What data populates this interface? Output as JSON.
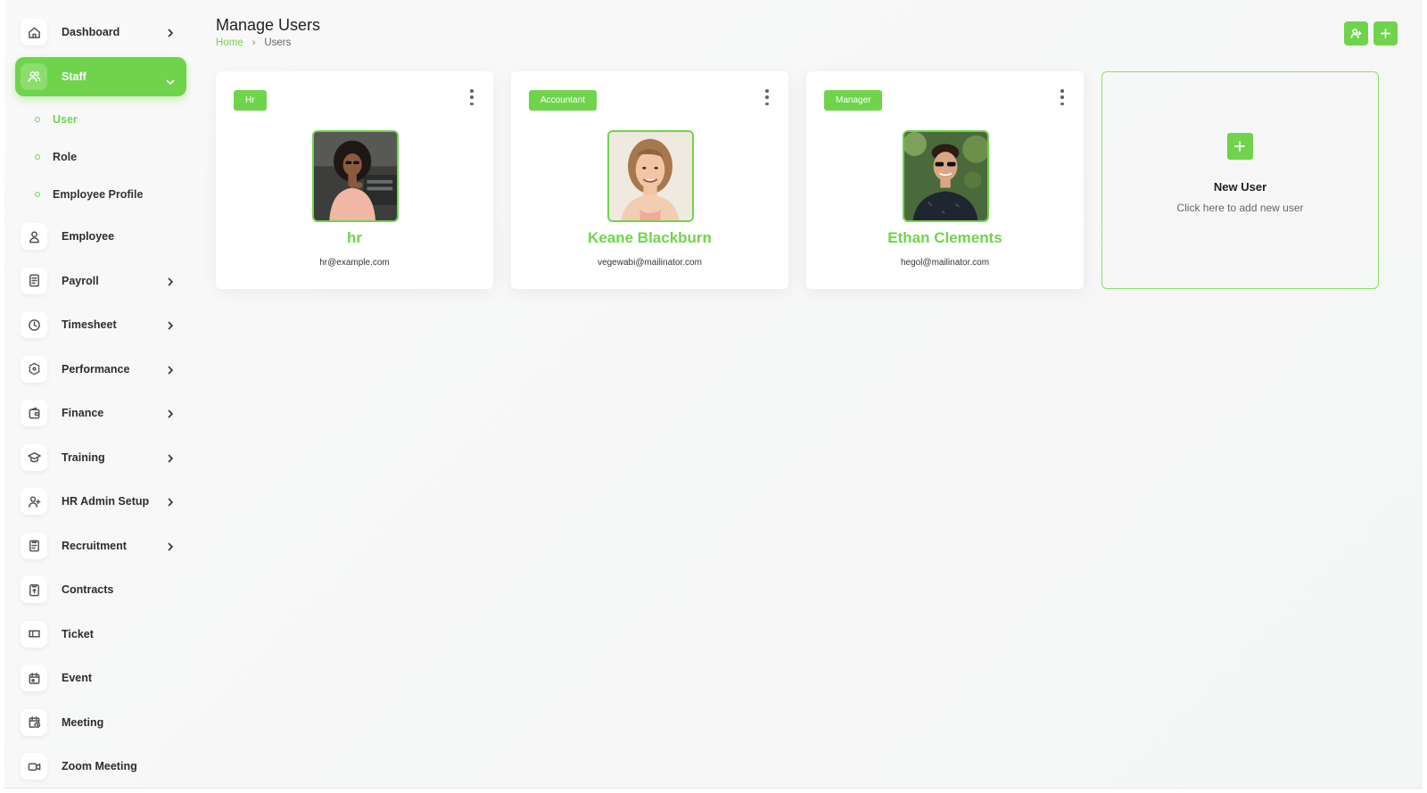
{
  "sidebar": {
    "items": [
      {
        "key": "dashboard",
        "label": "Dashboard",
        "icon": "home-icon",
        "has_chevron": true
      },
      {
        "key": "staff",
        "label": "Staff",
        "icon": "users-icon",
        "has_chevron": true,
        "expanded": true,
        "subitems": [
          {
            "label": "User",
            "current": true
          },
          {
            "label": "Role"
          },
          {
            "label": "Employee Profile"
          }
        ]
      },
      {
        "key": "employee",
        "label": "Employee",
        "icon": "person-icon",
        "has_chevron": false
      },
      {
        "key": "payroll",
        "label": "Payroll",
        "icon": "receipt-icon",
        "has_chevron": true
      },
      {
        "key": "timesheet",
        "label": "Timesheet",
        "icon": "clock-icon",
        "has_chevron": true
      },
      {
        "key": "performance",
        "label": "Performance",
        "icon": "cube-icon",
        "has_chevron": true
      },
      {
        "key": "finance",
        "label": "Finance",
        "icon": "wallet-icon",
        "has_chevron": true
      },
      {
        "key": "training",
        "label": "Training",
        "icon": "graduation-cap-icon",
        "has_chevron": true
      },
      {
        "key": "hr-admin-setup",
        "label": "HR Admin Setup",
        "icon": "user-plus-icon",
        "has_chevron": true
      },
      {
        "key": "recruitment",
        "label": "Recruitment",
        "icon": "clipboard-icon",
        "has_chevron": true
      },
      {
        "key": "contracts",
        "label": "Contracts",
        "icon": "contract-icon",
        "has_chevron": false
      },
      {
        "key": "ticket",
        "label": "Ticket",
        "icon": "ticket-icon",
        "has_chevron": false
      },
      {
        "key": "event",
        "label": "Event",
        "icon": "calendar-icon",
        "has_chevron": false
      },
      {
        "key": "meeting",
        "label": "Meeting",
        "icon": "calendar-clock-icon",
        "has_chevron": false
      },
      {
        "key": "zoom-meeting",
        "label": "Zoom Meeting",
        "icon": "video-icon",
        "has_chevron": false
      }
    ]
  },
  "header": {
    "title": "Manage Users",
    "breadcrumb": {
      "home": "Home",
      "current": "Users"
    },
    "actions": [
      {
        "icon": "user-plus-icon"
      },
      {
        "icon": "plus-icon"
      }
    ]
  },
  "users": [
    {
      "role": "Hr",
      "name": "hr",
      "email": "hr@example.com"
    },
    {
      "role": "Accountant",
      "name": "Keane Blackburn",
      "email": "vegewabi@mailinator.com"
    },
    {
      "role": "Manager",
      "name": "Ethan Clements",
      "email": "hegol@mailinator.com"
    }
  ],
  "new_user": {
    "title": "New User",
    "description": "Click here to add new user"
  },
  "colors": {
    "accent": "#6fd44b",
    "text": "#2d2d2d",
    "background": "#f6f7f7"
  }
}
